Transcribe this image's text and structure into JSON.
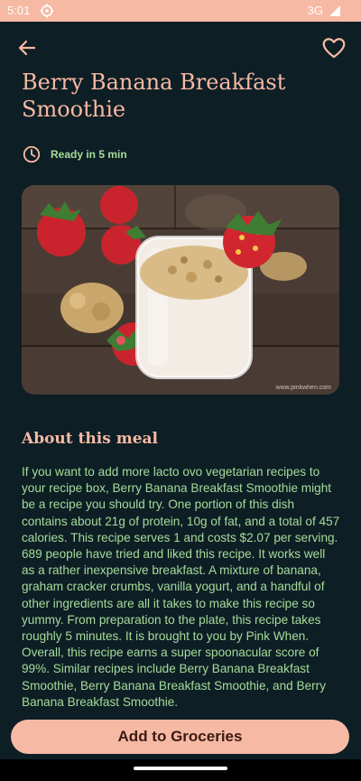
{
  "status_bar": {
    "time": "5:01",
    "network": "3G",
    "icons": [
      "settings-icon",
      "signal-icon"
    ]
  },
  "header": {
    "back_icon": "arrow-left-icon",
    "favorite_icon": "heart-outline-icon"
  },
  "recipe": {
    "title": "Berry Banana Breakfast Smoothie",
    "ready_icon": "clock-icon",
    "ready_label": "Ready in 5 min",
    "image_credit": "www.pinkwhen.com"
  },
  "about": {
    "heading": "About this meal",
    "text": "If you want to add more lacto ovo vegetarian recipes to your recipe box, Berry Banana Breakfast Smoothie might be a recipe you should try. One portion of this dish contains about 21g of protein, 10g of fat, and a total of 457 calories. This recipe serves 1 and costs $2.07 per serving. 689 people have tried and liked this recipe. It works well as a rather inexpensive breakfast. A mixture of banana, graham cracker crumbs, vanilla yogurt, and a handful of other ingredients are all it takes to make this recipe so yummy. From preparation to the plate, this recipe takes roughly 5 minutes. It is brought to you by Pink When. Overall, this recipe earns a super spoonacular score of 99%. Similar recipes include Berry Banana Breakfast Smoothie, Berry Banana Breakfast Smoothie, and Berry Banana Breakfast Smoothie."
  },
  "actions": {
    "add_label": "Add to Groceries"
  },
  "colors": {
    "background": "#0e1e25",
    "accent": "#f6b9a3",
    "secondary": "#a5dc9a",
    "button_text": "#3a1a14"
  }
}
